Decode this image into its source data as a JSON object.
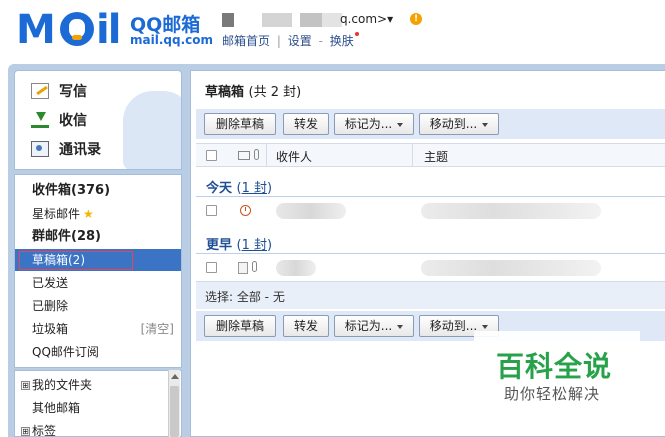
{
  "header": {
    "brand_title": "QQ邮箱",
    "brand_url": "mail.qq.com",
    "account_suffix": "q.com>▾",
    "warn_glyph": "!",
    "links": [
      "邮箱首页",
      "设置",
      "换肤"
    ],
    "link_separators": [
      "|",
      "-"
    ]
  },
  "sidebar": {
    "actions": [
      {
        "label": "写信",
        "icon": "write-icon"
      },
      {
        "label": "收信",
        "icon": "inbox-download-icon"
      },
      {
        "label": "通讯录",
        "icon": "contacts-icon"
      }
    ],
    "folders": [
      {
        "label": "收件箱(376)",
        "bold": true
      },
      {
        "label": "星标邮件",
        "star": "★"
      },
      {
        "label": "群邮件(28)",
        "bold": true
      },
      {
        "label": "草稿箱(2)",
        "active": true
      },
      {
        "label": "已发送"
      },
      {
        "label": "已删除"
      },
      {
        "label": "垃圾箱",
        "action": "[清空]"
      },
      {
        "label": "QQ邮件订阅"
      }
    ],
    "tree": [
      {
        "label": "我的文件夹",
        "box": "⊞"
      },
      {
        "label": "其他邮箱"
      },
      {
        "label": "标签",
        "box": "⊞"
      }
    ]
  },
  "main": {
    "title": "草稿箱",
    "count_text": "(共 2 封)",
    "toolbar": {
      "delete": "删除草稿",
      "forward": "转发",
      "mark_as": "标记为...",
      "move_to": "移动到..."
    },
    "columns": {
      "sender": "收件人",
      "subject": "主题"
    },
    "groups": [
      {
        "title": "今天",
        "count": "1 封"
      },
      {
        "title": "更早",
        "count": "1 封"
      }
    ],
    "select_text": "选择:  全部 - 无"
  },
  "watermark": {
    "big": "百科全说",
    "small": "助你轻松解决"
  },
  "colors": {
    "brand": "#1b6ad6",
    "active_folder": "#3b73c5",
    "frame": "#b9cde5",
    "watermark": "#27a24a"
  }
}
